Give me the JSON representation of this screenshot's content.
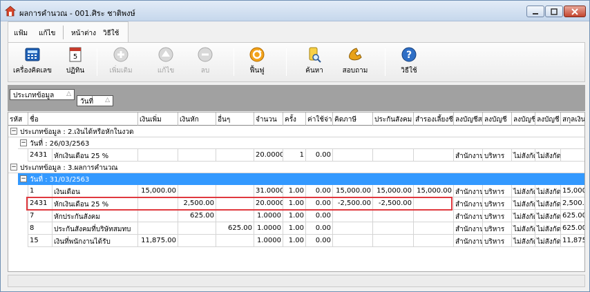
{
  "window": {
    "title": "ผลการคำนวณ - 001.ศิระ ชาติพงษ์"
  },
  "menu": {
    "items": [
      "แฟ้ม",
      "แก้ไข",
      "หน้าต่าง",
      "วิธีใช้"
    ]
  },
  "toolbar": {
    "calculator": "เครื่องคิดเลข",
    "calendar": "ปฏิทิน",
    "add": "เพิ่มเติม",
    "edit": "แก้ไข",
    "delete": "ลบ",
    "restore": "ฟื้นฟู",
    "search": "ค้นหา",
    "inquiry": "สอบถาม",
    "help": "วิธีใช้",
    "calendar_day": "5"
  },
  "group_panel": {
    "chip_type": "ประเภทข้อมูล",
    "chip_date": "วันที่",
    "sort_glyph": "△"
  },
  "columns": [
    "รหัส",
    "ชื่อ",
    "เงินเพิ่ม",
    "เงินหัก",
    "อื่นๆ",
    "จำนวน",
    "ครั้ง",
    "ค่าใช้จ่าย",
    "คิดภาษี",
    "ประกันสังคม",
    "สำรองเลี้ยงชีพ",
    "ลงบัญชีส",
    "ลงบัญชี",
    "ลงบัญชี",
    "ลงบัญชี",
    "สกุลเงิน"
  ],
  "groups": [
    {
      "label": "ประเภทข้อมูล : 2.เงินได้หรือหักในงวด",
      "subgroups": [
        {
          "label": "วันที่ : 26/03/2563",
          "rows": [
            {
              "code": "2431",
              "name": "หักเงินเดือน 25 %",
              "plus": "",
              "minus": "",
              "other": "",
              "amount": "20.0000",
              "times": "1",
              "expense": "0.00",
              "tax": "",
              "sso": "",
              "pf": "",
              "acc1": "สำนักงาน",
              "acc2": "บริหาร",
              "acc3": "ไม่สังกัด",
              "acc4": "ไม่สังกัด",
              "currency": ""
            }
          ]
        }
      ]
    },
    {
      "label": "ประเภทข้อมูล : 3.ผลการคำนวณ",
      "subgroups": [
        {
          "label": "วันที่ : 31/03/2563",
          "rows": [
            {
              "code": "1",
              "name": "เงินเดือน",
              "plus": "15,000.00",
              "minus": "",
              "other": "",
              "amount": "31.0000",
              "times": "1.00",
              "expense": "0.00",
              "tax": "15,000.00",
              "sso": "15,000.00",
              "pf": "15,000.00",
              "acc1": "สำนักงาน",
              "acc2": "บริหาร",
              "acc3": "ไม่สังกัด",
              "acc4": "ไม่สังกัด",
              "currency": "15,000"
            },
            {
              "code": "2431",
              "name": "หักเงินเดือน 25 %",
              "plus": "",
              "minus": "2,500.00",
              "other": "",
              "amount": "20.0000",
              "times": "1.00",
              "expense": "0.00",
              "tax": "-2,500.00",
              "sso": "-2,500.00",
              "pf": "",
              "acc1": "สำนักงาน",
              "acc2": "บริหาร",
              "acc3": "ไม่สังกัด",
              "acc4": "ไม่สังกัด",
              "currency": "2,500.0"
            },
            {
              "code": "7",
              "name": "หักประกันสังคม",
              "plus": "",
              "minus": "625.00",
              "other": "",
              "amount": "1.0000",
              "times": "1.00",
              "expense": "0.00",
              "tax": "",
              "sso": "",
              "pf": "",
              "acc1": "สำนักงาน",
              "acc2": "บริหาร",
              "acc3": "ไม่สังกัด",
              "acc4": "ไม่สังกัด",
              "currency": "625.00"
            },
            {
              "code": "8",
              "name": "ประกันสังคมที่บริษัทสมทบ",
              "plus": "",
              "minus": "",
              "other": "625.00",
              "amount": "1.0000",
              "times": "1.00",
              "expense": "0.00",
              "tax": "",
              "sso": "",
              "pf": "",
              "acc1": "สำนักงาน",
              "acc2": "บริหาร",
              "acc3": "ไม่สังกัด",
              "acc4": "ไม่สังกัด",
              "currency": "625.00"
            },
            {
              "code": "15",
              "name": "เงินที่พนักงานได้รับ",
              "plus": "11,875.00",
              "minus": "",
              "other": "",
              "amount": "1.0000",
              "times": "1.00",
              "expense": "0.00",
              "tax": "",
              "sso": "",
              "pf": "",
              "acc1": "สำนักงาน",
              "acc2": "บริหาร",
              "acc3": "ไม่สังกัด",
              "acc4": "ไม่สังกัด",
              "currency": "11,875"
            }
          ]
        }
      ]
    }
  ],
  "colors": {
    "selected_row": "#3399ff",
    "highlight": "#e0383e"
  }
}
